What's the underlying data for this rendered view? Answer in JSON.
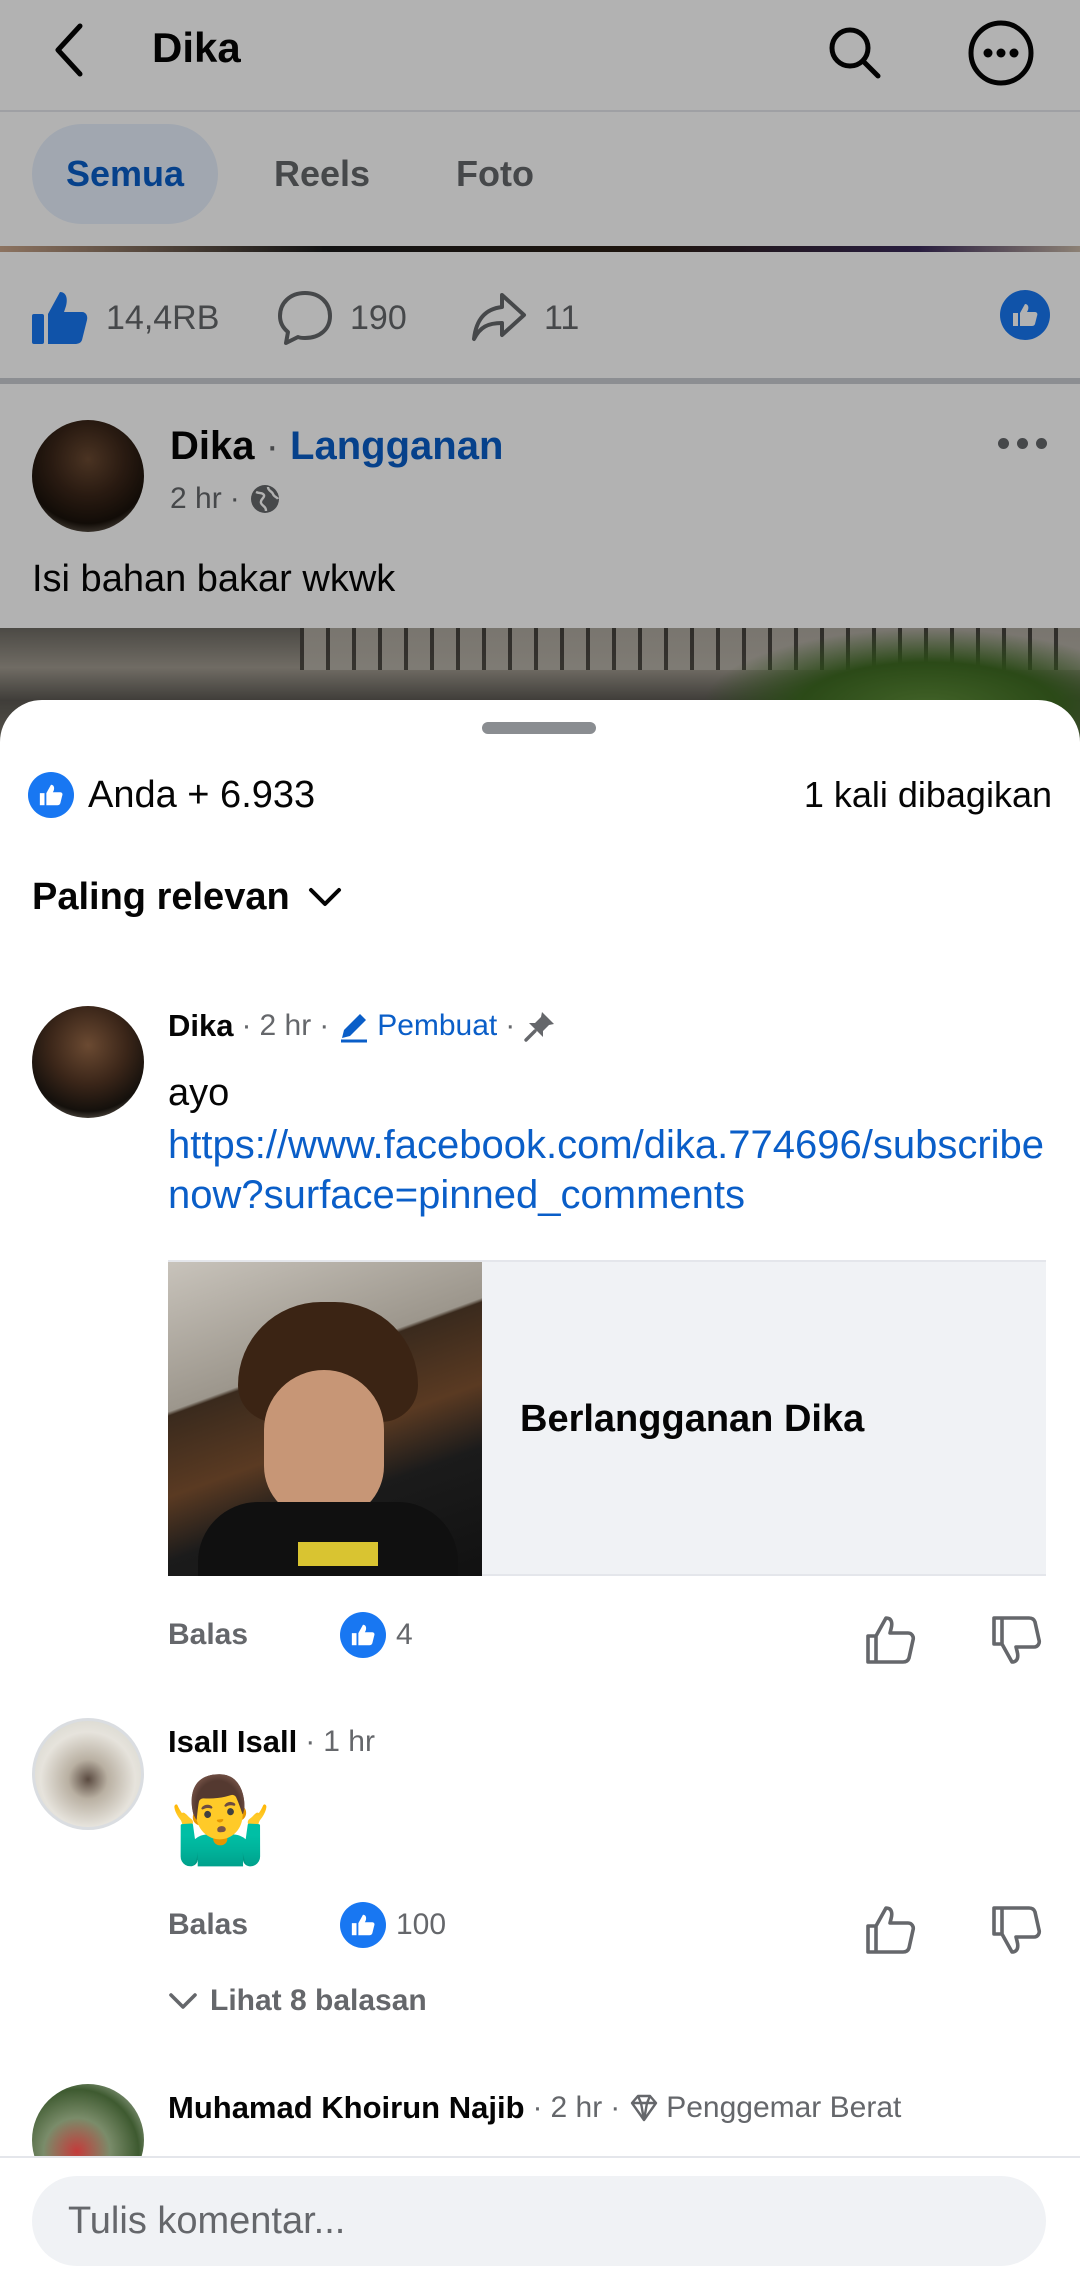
{
  "header": {
    "title": "Dika"
  },
  "tabs": [
    {
      "label": "Semua",
      "active": true
    },
    {
      "label": "Reels",
      "active": false
    },
    {
      "label": "Foto",
      "active": false
    }
  ],
  "post_actions": {
    "likes": "14,4RB",
    "comments": "190",
    "shares": "11"
  },
  "post": {
    "author": "Dika",
    "separator": " · ",
    "subscribe_label": "Langganan",
    "time": "2 hr",
    "meta_sep": "·",
    "text": "Isi bahan bakar wkwk"
  },
  "sheet": {
    "reactions": "Anda + 6.933",
    "shares": "1 kali dibagikan",
    "sort_label": "Paling relevan"
  },
  "comments": [
    {
      "author": "Dika",
      "time": "2 hr",
      "badge": "Pembuat",
      "text": "ayo",
      "link": "https://www.facebook.com/dika.774696/subscribenow?surface=pinned_comments",
      "card_title": "Berlangganan Dika",
      "reply_label": "Balas",
      "likes": "4"
    },
    {
      "author": "Isall Isall",
      "time": "1 hr",
      "emoji": "🤷‍♂️",
      "reply_label": "Balas",
      "likes": "100",
      "view_replies": "Lihat 8 balasan"
    },
    {
      "author": "Muhamad Khoirun Najib",
      "time": "2 hr",
      "badge": "Penggemar Berat"
    }
  ],
  "composer": {
    "placeholder": "Tulis komentar..."
  },
  "colors": {
    "accent": "#1877f2",
    "link": "#0a5ec8",
    "muted": "#65676b"
  }
}
